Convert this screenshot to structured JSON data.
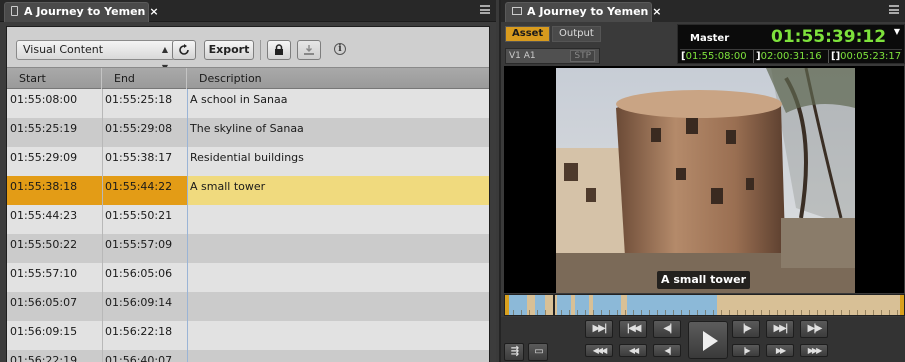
{
  "left_panel": {
    "tab_title": "A Journey to Yemen",
    "close_glyph": "×",
    "toolbar": {
      "dropdown_value": "Visual Content",
      "export_label": "Export",
      "refresh_icon": "refresh-icon",
      "lock_icon": "lock-icon",
      "download_icon": "download-icon",
      "info_icon": "info-icon",
      "info_glyph": "i"
    },
    "columns": [
      "Start",
      "End",
      "Description"
    ],
    "rows": [
      {
        "start": "01:55:08:00",
        "end": "01:55:25:18",
        "desc": "A school in Sanaa"
      },
      {
        "start": "01:55:25:19",
        "end": "01:55:29:08",
        "desc": "The skyline of Sanaa"
      },
      {
        "start": "01:55:29:09",
        "end": "01:55:38:17",
        "desc": "Residential buildings"
      },
      {
        "start": "01:55:38:18",
        "end": "01:55:44:22",
        "desc": "A small tower",
        "selected": true
      },
      {
        "start": "01:55:44:23",
        "end": "01:55:50:21",
        "desc": ""
      },
      {
        "start": "01:55:50:22",
        "end": "01:55:57:09",
        "desc": ""
      },
      {
        "start": "01:55:57:10",
        "end": "01:56:05:06",
        "desc": ""
      },
      {
        "start": "01:56:05:07",
        "end": "01:56:09:14",
        "desc": ""
      },
      {
        "start": "01:56:09:15",
        "end": "01:56:22:18",
        "desc": ""
      },
      {
        "start": "01:56:22:19",
        "end": "01:56:40:07",
        "desc": ""
      }
    ],
    "colors": {
      "selected_row": "#f0da7e",
      "selected_time": "#e39c16"
    }
  },
  "right_panel": {
    "tab_title": "A Journey to Yemen",
    "close_glyph": "×",
    "asset_label": "Asset",
    "output_label": "Output",
    "tracks": "V1 A1",
    "stp": "STP",
    "timecode": {
      "label": "Master",
      "main": "01:55:39:12",
      "in_mark": "[",
      "in": "01:55:08:00",
      "out_mark": "]",
      "out": "02:00:31:16",
      "dur_mark": "[]",
      "duration": "00:05:23:17",
      "dropdown_glyph": "▼"
    },
    "caption": "A small tower",
    "controls": {
      "row1": [
        "▶▶|",
        "|◀◀",
        "◀|",
        "|▶",
        "▶▶|",
        "▶|▶"
      ],
      "row2": [
        "◀◀◀",
        "◀◀",
        "◀|",
        "|▶",
        "▶▶",
        "▶▶▶"
      ],
      "play_icon": "play-icon"
    },
    "colors": {
      "timecode_green": "#7ee23c",
      "asset_active": "#d89b1e",
      "timeline_clip": "#8cb9d8"
    }
  }
}
